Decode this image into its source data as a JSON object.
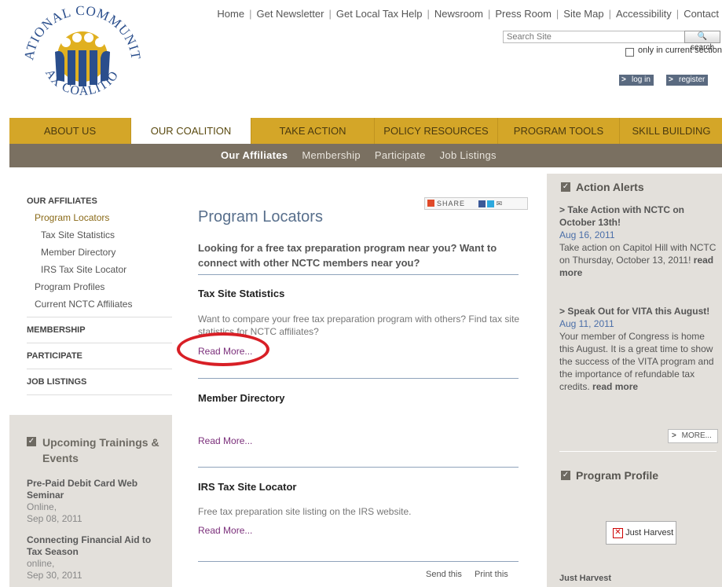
{
  "logo": {
    "text_top": "NATIONAL COMMUNITY",
    "text_bottom": "TAX COALITION"
  },
  "topnav": [
    "Home",
    "Get Newsletter",
    "Get Local Tax Help",
    "Newsroom",
    "Press Room",
    "Site Map",
    "Accessibility",
    "Contact"
  ],
  "search": {
    "placeholder": "Search Site",
    "button": "search",
    "only_current": "only in current section"
  },
  "auth": {
    "login": "log in",
    "register": "register"
  },
  "mainnav": [
    "ABOUT US",
    "OUR COALITION",
    "TAKE ACTION",
    "POLICY RESOURCES",
    "PROGRAM TOOLS",
    "SKILL BUILDING"
  ],
  "subnav": [
    "Our Affiliates",
    "Membership",
    "Participate",
    "Job Listings"
  ],
  "leftnav": {
    "heading": "OUR AFFILIATES",
    "program_locators": "Program Locators",
    "tax_site_statistics": "Tax Site Statistics",
    "member_directory": "Member Directory",
    "irs_tax_site_locator": "IRS Tax Site Locator",
    "program_profiles": "Program Profiles",
    "current_affiliates": "Current NCTC Affiliates",
    "membership": "MEMBERSHIP",
    "participate": "PARTICIPATE",
    "job_listings": "JOB LISTINGS"
  },
  "trainings": {
    "heading": "Upcoming Trainings & Events",
    "events": [
      {
        "title": "Pre-Paid Debit Card Web Seminar",
        "location": "Online,",
        "date": "Sep 08, 2011"
      },
      {
        "title": "Connecting Financial Aid to Tax Season",
        "location": "online,",
        "date": "Sep 30, 2011"
      }
    ]
  },
  "share": {
    "label": "SHARE"
  },
  "page": {
    "title": "Program Locators",
    "intro": "Looking for a free tax preparation program near you? Want to connect with other NCTC members near you?",
    "sections": [
      {
        "heading": "Tax Site Statistics",
        "text": "Want to compare your free tax preparation program with others? Find tax site statistics for NCTC affiliates?",
        "read_more": "Read More..."
      },
      {
        "heading": "Member Directory",
        "text": "",
        "read_more": "Read More..."
      },
      {
        "heading": "IRS Tax Site Locator",
        "text": "Free tax preparation site listing on the IRS website.",
        "read_more": "Read More..."
      }
    ],
    "send_this": "Send this",
    "print_this": "Print this"
  },
  "right": {
    "alerts_heading": "Action Alerts",
    "alerts": [
      {
        "title": "> Take Action with NCTC on October 13th!",
        "date": "Aug 16, 2011",
        "text": "Take action on Capitol Hill with NCTC on Thursday, October 13, 2011!",
        "read_more": "read more"
      },
      {
        "title": "> Speak Out for VITA this August!",
        "date": "Aug 11, 2011",
        "text": "Your member of Congress is home this August. It is a great time to show the success of the VITA program and the importance of refundable tax credits.",
        "read_more": "read more"
      }
    ],
    "more": "MORE...",
    "profile_heading": "Program Profile",
    "profile_image_alt": "Just Harvest",
    "profile_title": "Just Harvest"
  },
  "colors": {
    "gold_nav": "#d4a628",
    "sub_nav": "#7a7061",
    "sidebar_bg": "#e3e0db",
    "title_blue": "#586f8c",
    "highlight_red": "#d81f26"
  }
}
